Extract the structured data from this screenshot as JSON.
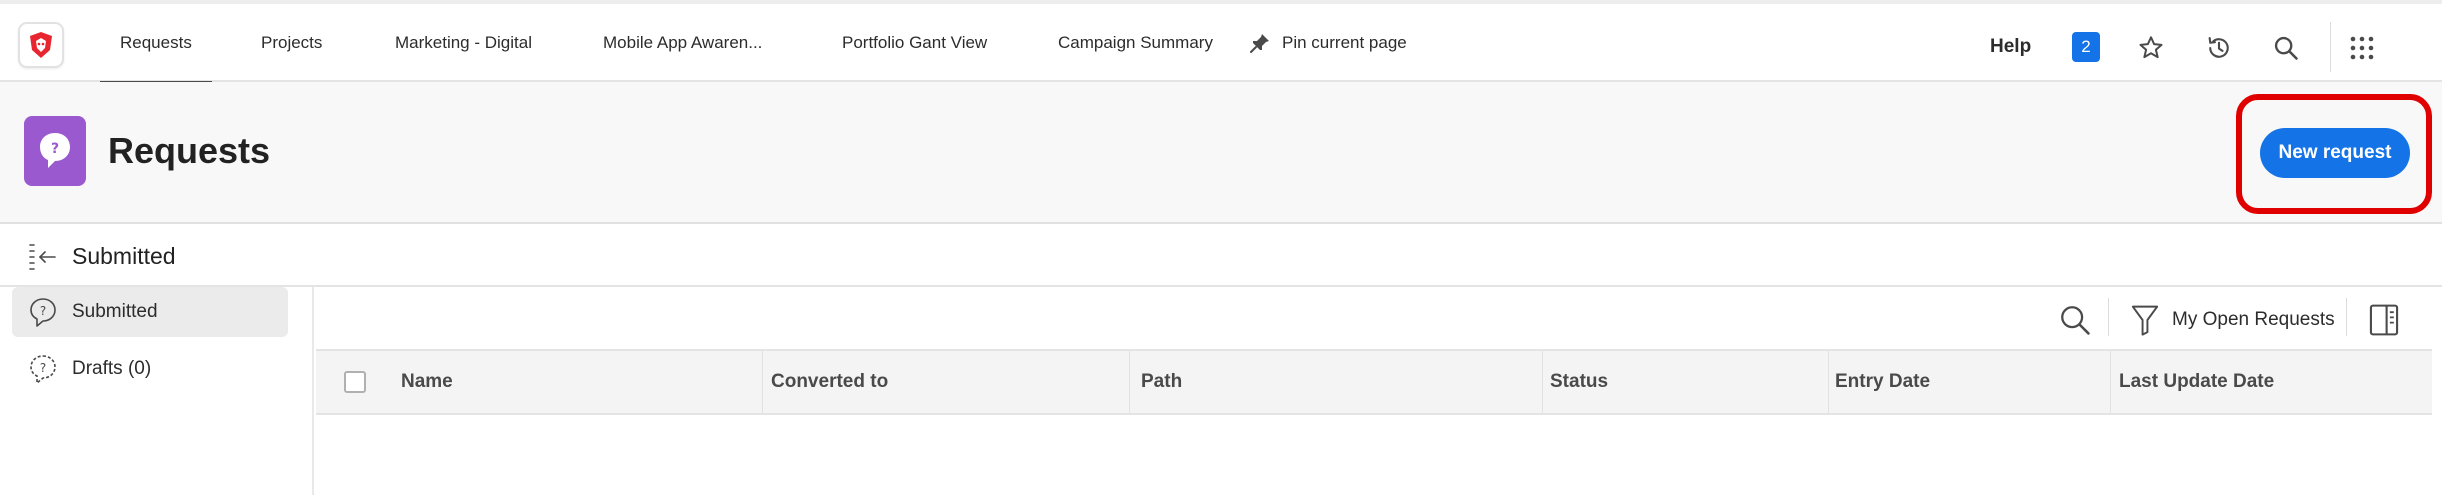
{
  "nav": {
    "tabs": [
      {
        "label": "Requests",
        "active": true
      },
      {
        "label": "Projects"
      },
      {
        "label": "Marketing - Digital"
      },
      {
        "label": "Mobile App Awaren..."
      },
      {
        "label": "Portfolio Gant View"
      },
      {
        "label": "Campaign Summary"
      }
    ],
    "pin_label": "Pin current page",
    "help_label": "Help",
    "notification_count": "2",
    "icons": [
      "pin-icon",
      "star-icon",
      "history-icon",
      "search-icon",
      "apps-grid-icon"
    ]
  },
  "header": {
    "title": "Requests",
    "new_request_label": "New request",
    "icon": "request-question-icon",
    "accent_color": "#1473e6",
    "app_icon_color": "#9b59d0",
    "highlight_color": "#e00000"
  },
  "breadcrumb": {
    "label": "Submitted",
    "icon": "collapse-panel-icon"
  },
  "left_panel": {
    "items": [
      {
        "label": "Submitted",
        "icon": "question-bubble-icon",
        "selected": true
      },
      {
        "label": "Drafts (0)",
        "icon": "draft-question-icon",
        "selected": false
      }
    ]
  },
  "toolbar": {
    "filter_label": "My Open Requests",
    "icons": [
      "search-icon",
      "filter-icon",
      "column-panel-icon"
    ]
  },
  "table": {
    "columns": [
      "Name",
      "Converted to",
      "Path",
      "Status",
      "Entry Date",
      "Last Update Date"
    ],
    "rows": []
  }
}
